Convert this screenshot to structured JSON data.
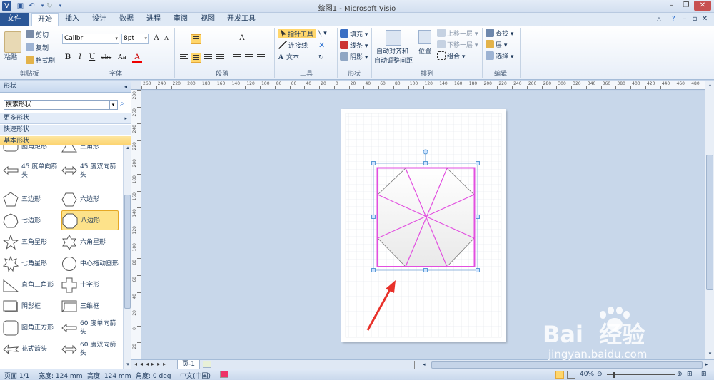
{
  "window": {
    "title": "绘图1 - Microsoft Visio"
  },
  "tabs": [
    {
      "label": "文件"
    },
    {
      "label": "开始"
    },
    {
      "label": "插入"
    },
    {
      "label": "设计"
    },
    {
      "label": "数据"
    },
    {
      "label": "进程"
    },
    {
      "label": "审阅"
    },
    {
      "label": "视图"
    },
    {
      "label": "开发工具"
    }
  ],
  "ribbon": {
    "clipboard": {
      "paste": "粘贴",
      "cut": "剪切",
      "copy": "复制",
      "format_painter": "格式刷",
      "label": "剪贴板"
    },
    "font": {
      "name": "Calibri",
      "size": "8pt",
      "bold": "B",
      "italic": "I",
      "underline": "U",
      "strike": "abc",
      "case": "Aa",
      "color": "A",
      "label": "字体"
    },
    "paragraph": {
      "label": "段落",
      "text_dir": "A"
    },
    "tools": {
      "pointer": "指针工具",
      "connector": "连接线",
      "text": "文本",
      "label": "工具"
    },
    "shape": {
      "fill": "填充",
      "line": "线条",
      "shadow": "阴影",
      "label": "形状"
    },
    "arrange": {
      "auto_align_1": "自动对齐和",
      "auto_align_2": "自动调整间距",
      "position": "位置",
      "bring_forward": "上移一层",
      "send_backward": "下移一层",
      "group": "组合",
      "label": "排列"
    },
    "editing": {
      "find": "查找",
      "layers": "层",
      "select": "选择",
      "label": "编辑"
    }
  },
  "shapes_panel": {
    "title": "形状",
    "search_value": "搜索形状",
    "stencils": [
      "更多形状",
      "快速形状",
      "基本形状"
    ],
    "items": [
      {
        "label": "圆角矩形",
        "icon": "rounded-rect-icon"
      },
      {
        "label": "三角形",
        "icon": "triangle-icon"
      },
      {
        "label": "45 度单向箭头",
        "icon": "single-arrow-icon"
      },
      {
        "label": "45 度双向箭头",
        "icon": "double-arrow-icon"
      },
      {
        "label": "五边形",
        "icon": "pentagon-icon"
      },
      {
        "label": "六边形",
        "icon": "hexagon-icon"
      },
      {
        "label": "七边形",
        "icon": "heptagon-icon"
      },
      {
        "label": "八边形",
        "icon": "octagon-icon"
      },
      {
        "label": "五角星形",
        "icon": "five-star-icon"
      },
      {
        "label": "六角星形",
        "icon": "six-star-icon"
      },
      {
        "label": "七角星形",
        "icon": "seven-star-icon"
      },
      {
        "label": "中心拖动圆形",
        "icon": "circle-icon"
      },
      {
        "label": "直角三角形",
        "icon": "right-triangle-icon"
      },
      {
        "label": "十字形",
        "icon": "cross-icon"
      },
      {
        "label": "阴影框",
        "icon": "shadow-box-icon"
      },
      {
        "label": "三维框",
        "icon": "3d-box-icon"
      },
      {
        "label": "圆角正方形",
        "icon": "rounded-square-icon"
      },
      {
        "label": "60 度单向箭头",
        "icon": "single-arrow-icon"
      },
      {
        "label": "花式箭头",
        "icon": "fancy-arrow-icon"
      },
      {
        "label": "60 度双向箭头",
        "icon": "double-arrow-icon"
      }
    ]
  },
  "ruler": {
    "h_ticks": [
      "260",
      "240",
      "220",
      "200",
      "180",
      "160",
      "140",
      "120",
      "100",
      "80",
      "60",
      "40",
      "20",
      "0",
      "20",
      "40",
      "60",
      "80",
      "100",
      "120",
      "140",
      "160",
      "180",
      "200",
      "220",
      "240",
      "260",
      "280",
      "300",
      "320",
      "340",
      "360",
      "380",
      "400",
      "420",
      "440",
      "460",
      "480"
    ],
    "v_ticks": [
      "280",
      "260",
      "240",
      "220",
      "200",
      "180",
      "160",
      "140",
      "120",
      "100",
      "80",
      "60",
      "40",
      "20",
      "0",
      "20"
    ]
  },
  "page_tab": "页-1",
  "status": {
    "page": "页面 1/1",
    "width": "宽度: 124 mm",
    "height": "高度: 124 mm",
    "angle": "角度: 0 deg",
    "language": "中文(中国)",
    "zoom": "40%"
  },
  "watermark": {
    "brand": "Bai  经验",
    "url": "jingyan.baidu.com"
  },
  "colors": {
    "selection": "#e24fe0",
    "arrow": "#e8312a",
    "handle": "#5b9bd5"
  }
}
